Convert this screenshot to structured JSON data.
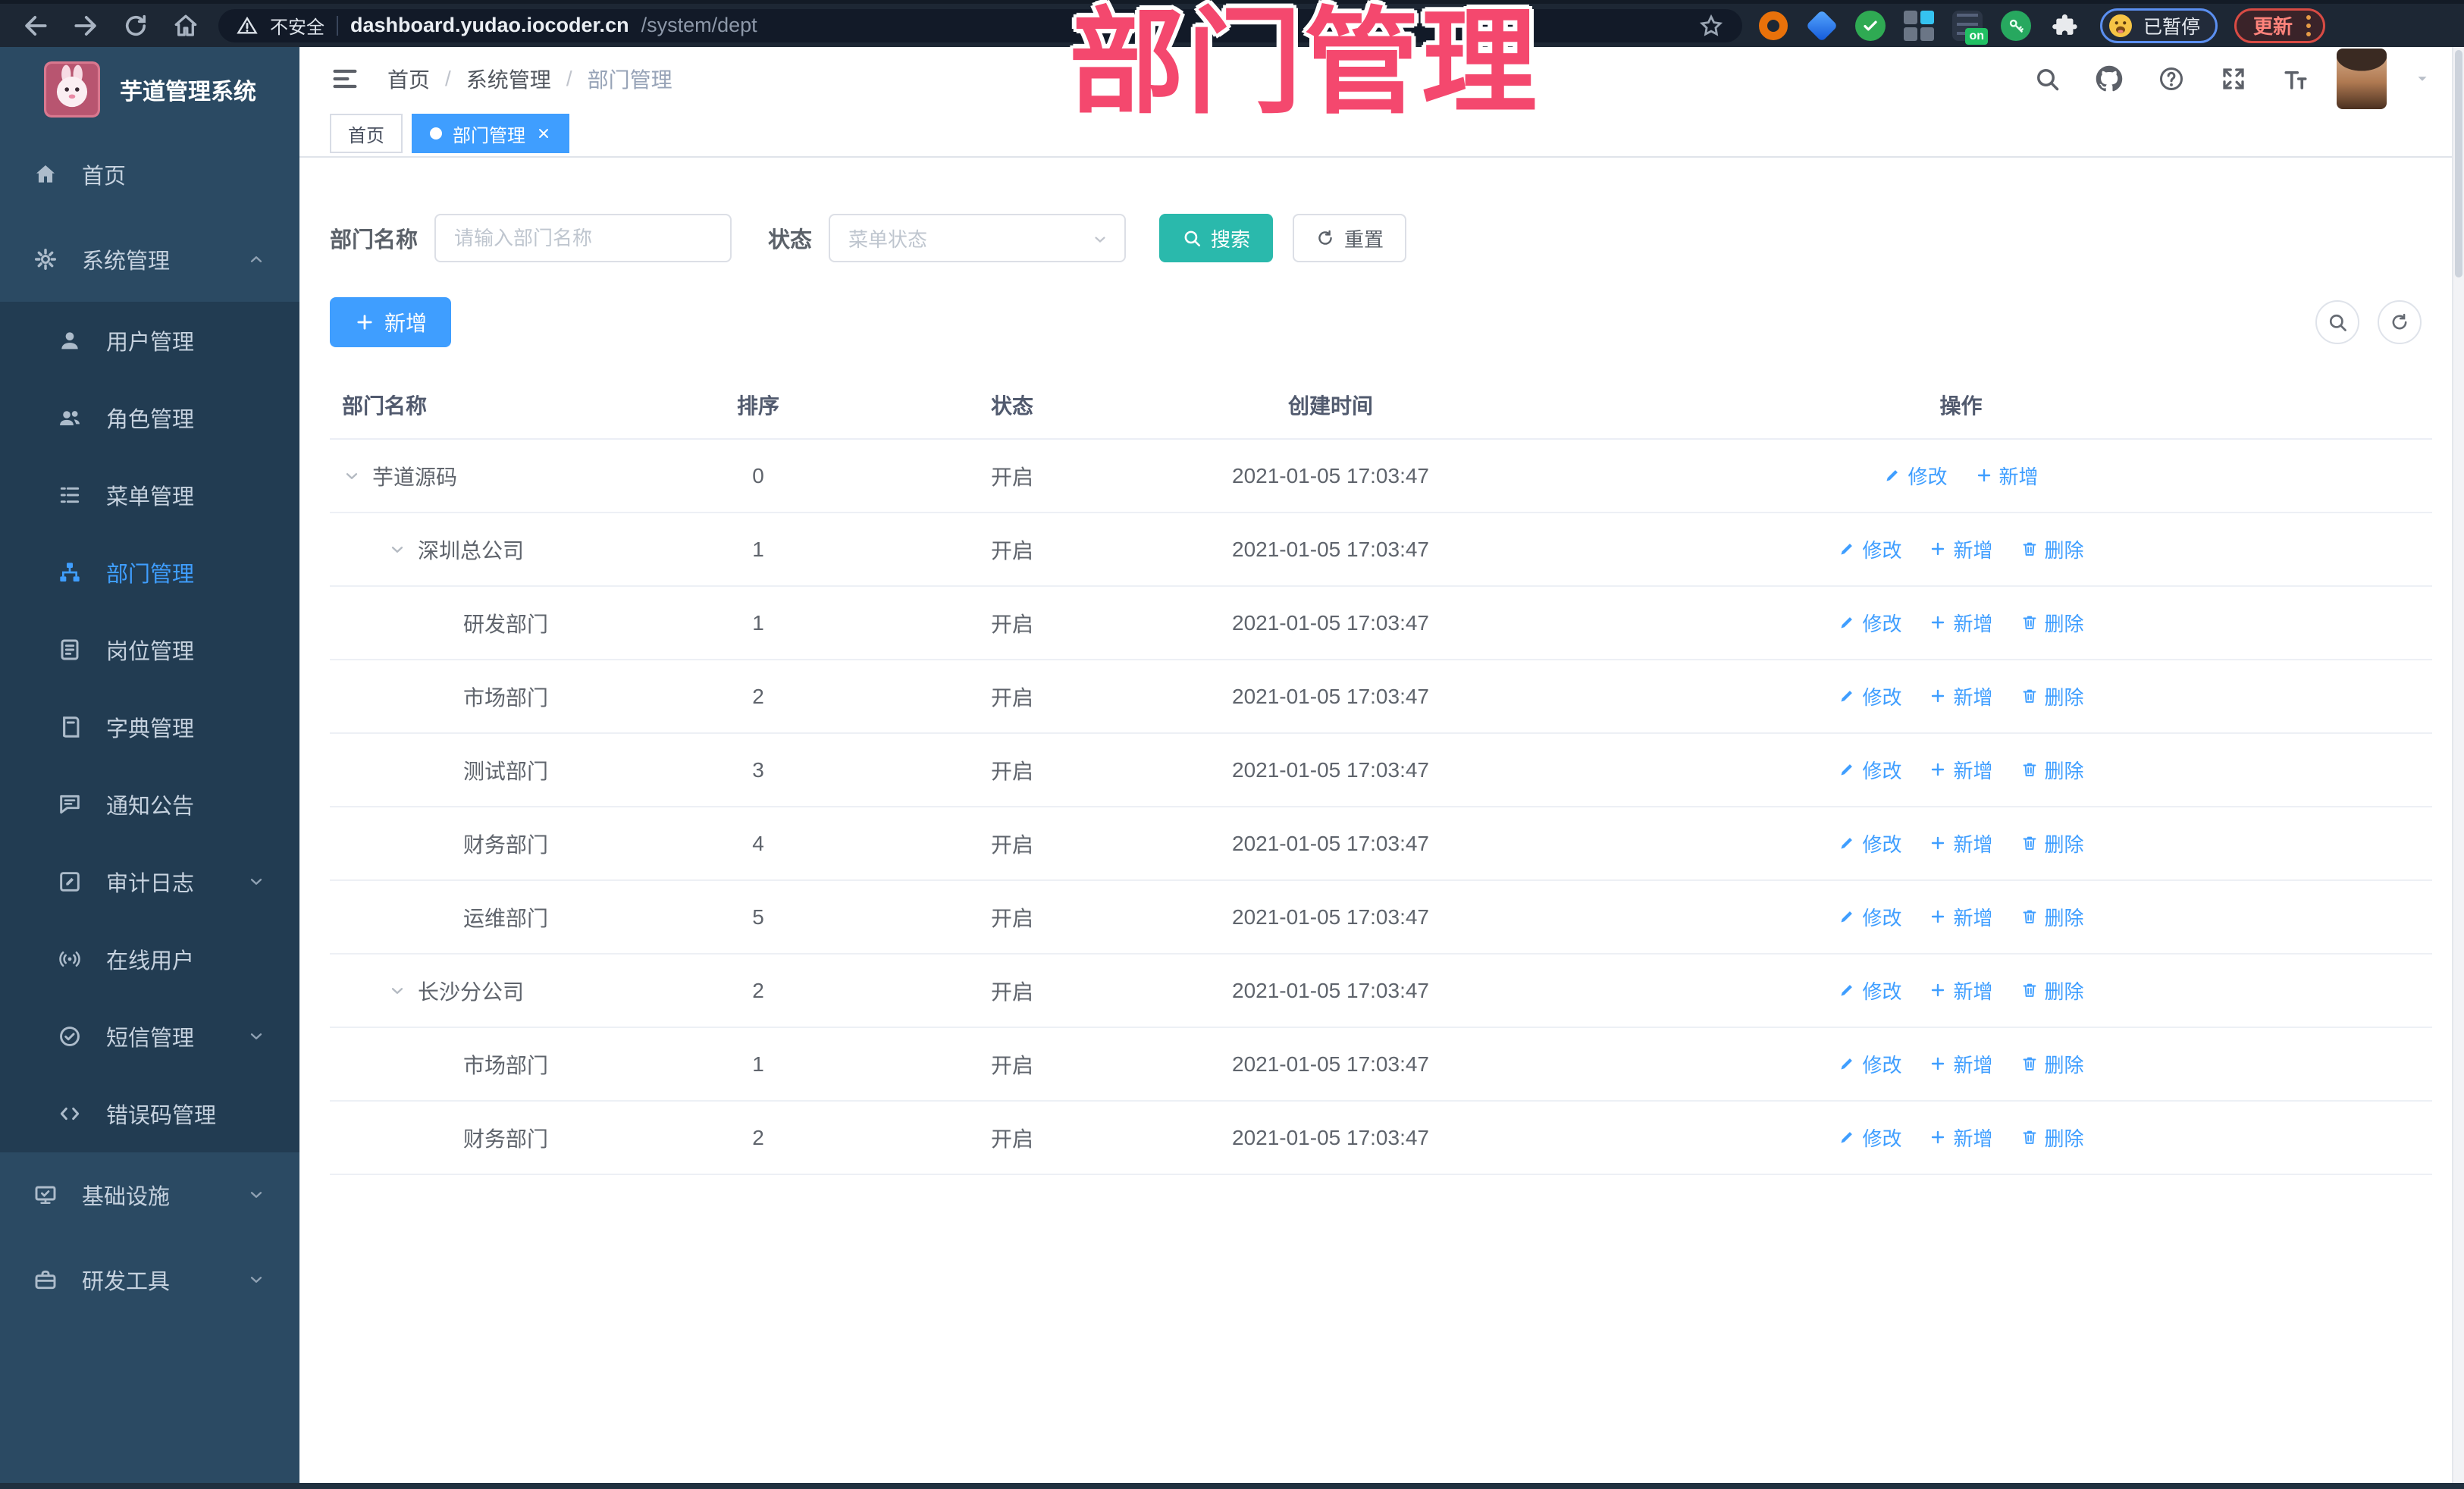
{
  "colors": {
    "accent_blue": "#409eff",
    "teal_button": "#2ab9ac",
    "overlay_pink": "#f4486e",
    "sidebar_bg": "#2b4a63",
    "sidebar_submenu_bg": "#223c52",
    "browser_bar_bg": "#1d2734"
  },
  "overlay": {
    "title": "部门管理"
  },
  "browser": {
    "security_label": "不安全",
    "url_host": "dashboard.yudao.iocoder.cn",
    "url_path": "/system/dept",
    "profile_status": "已暂停",
    "update_label": "更新",
    "extension_badge": "on",
    "extensions": [
      {
        "name": "extension-orange-ring-icon",
        "kind": "donut"
      },
      {
        "name": "extension-blue-gem-icon",
        "kind": "gem"
      },
      {
        "name": "extension-green-check-icon",
        "kind": "check"
      },
      {
        "name": "extension-grid-icon",
        "kind": "grid"
      },
      {
        "name": "extension-list-on-badge-icon",
        "kind": "listbadge"
      },
      {
        "name": "extension-green-key-icon",
        "kind": "green"
      },
      {
        "name": "extension-puzzle-icon",
        "kind": "puzzle"
      }
    ]
  },
  "sidebar": {
    "app_title": "芋道管理系统",
    "menu": [
      {
        "label": "首页",
        "icon": "home-icon"
      },
      {
        "label": "系统管理",
        "icon": "gear-icon",
        "chevron": "up",
        "expanded": true,
        "children": [
          {
            "label": "用户管理",
            "icon": "user-icon"
          },
          {
            "label": "角色管理",
            "icon": "users-icon"
          },
          {
            "label": "菜单管理",
            "icon": "menu-list-icon"
          },
          {
            "label": "部门管理",
            "icon": "org-tree-icon",
            "active": true
          },
          {
            "label": "岗位管理",
            "icon": "badge-icon"
          },
          {
            "label": "字典管理",
            "icon": "dictionary-icon"
          },
          {
            "label": "通知公告",
            "icon": "announcement-icon"
          },
          {
            "label": "审计日志",
            "icon": "audit-log-icon",
            "chevron": "down"
          },
          {
            "label": "在线用户",
            "icon": "online-users-icon"
          },
          {
            "label": "短信管理",
            "icon": "sms-icon",
            "chevron": "down"
          },
          {
            "label": "错误码管理",
            "icon": "error-code-icon"
          }
        ]
      },
      {
        "label": "基础设施",
        "icon": "infrastructure-icon",
        "chevron": "down"
      },
      {
        "label": "研发工具",
        "icon": "dev-tools-icon",
        "chevron": "down"
      }
    ]
  },
  "header": {
    "breadcrumb": [
      "首页",
      "系统管理",
      "部门管理"
    ],
    "breadcrumb_separator": "/",
    "tools": [
      {
        "name": "search-icon"
      },
      {
        "name": "github-icon"
      },
      {
        "name": "help-icon"
      },
      {
        "name": "fullscreen-icon"
      },
      {
        "name": "font-size-icon"
      }
    ]
  },
  "tabs": [
    {
      "label": "首页",
      "active": false
    },
    {
      "label": "部门管理",
      "active": true,
      "closable": true
    }
  ],
  "filters": {
    "name_label": "部门名称",
    "name_placeholder": "请输入部门名称",
    "status_label": "状态",
    "status_placeholder": "菜单状态",
    "search_label": "搜索",
    "reset_label": "重置"
  },
  "toolbar": {
    "add_label": "新增",
    "tools": [
      {
        "name": "search-icon"
      },
      {
        "name": "refresh-icon"
      }
    ]
  },
  "table": {
    "columns": [
      "部门名称",
      "排序",
      "状态",
      "创建时间",
      "操作"
    ],
    "rows": [
      {
        "name": "芋道源码",
        "level": 0,
        "expandable": true,
        "sort": "0",
        "status": "开启",
        "created": "2021-01-05 17:03:47",
        "actions": [
          {
            "label": "修改",
            "icon": "pencil-icon"
          },
          {
            "label": "新增",
            "icon": "plus-icon"
          }
        ]
      },
      {
        "name": "深圳总公司",
        "level": 1,
        "expandable": true,
        "sort": "1",
        "status": "开启",
        "created": "2021-01-05 17:03:47",
        "actions": [
          {
            "label": "修改",
            "icon": "pencil-icon"
          },
          {
            "label": "新增",
            "icon": "plus-icon"
          },
          {
            "label": "删除",
            "icon": "trash-icon"
          }
        ]
      },
      {
        "name": "研发部门",
        "level": 2,
        "expandable": false,
        "sort": "1",
        "status": "开启",
        "created": "2021-01-05 17:03:47",
        "actions": [
          {
            "label": "修改",
            "icon": "pencil-icon"
          },
          {
            "label": "新增",
            "icon": "plus-icon"
          },
          {
            "label": "删除",
            "icon": "trash-icon"
          }
        ]
      },
      {
        "name": "市场部门",
        "level": 2,
        "expandable": false,
        "sort": "2",
        "status": "开启",
        "created": "2021-01-05 17:03:47",
        "actions": [
          {
            "label": "修改",
            "icon": "pencil-icon"
          },
          {
            "label": "新增",
            "icon": "plus-icon"
          },
          {
            "label": "删除",
            "icon": "trash-icon"
          }
        ]
      },
      {
        "name": "测试部门",
        "level": 2,
        "expandable": false,
        "sort": "3",
        "status": "开启",
        "created": "2021-01-05 17:03:47",
        "actions": [
          {
            "label": "修改",
            "icon": "pencil-icon"
          },
          {
            "label": "新增",
            "icon": "plus-icon"
          },
          {
            "label": "删除",
            "icon": "trash-icon"
          }
        ]
      },
      {
        "name": "财务部门",
        "level": 2,
        "expandable": false,
        "sort": "4",
        "status": "开启",
        "created": "2021-01-05 17:03:47",
        "actions": [
          {
            "label": "修改",
            "icon": "pencil-icon"
          },
          {
            "label": "新增",
            "icon": "plus-icon"
          },
          {
            "label": "删除",
            "icon": "trash-icon"
          }
        ]
      },
      {
        "name": "运维部门",
        "level": 2,
        "expandable": false,
        "sort": "5",
        "status": "开启",
        "created": "2021-01-05 17:03:47",
        "actions": [
          {
            "label": "修改",
            "icon": "pencil-icon"
          },
          {
            "label": "新增",
            "icon": "plus-icon"
          },
          {
            "label": "删除",
            "icon": "trash-icon"
          }
        ]
      },
      {
        "name": "长沙分公司",
        "level": 1,
        "expandable": true,
        "sort": "2",
        "status": "开启",
        "created": "2021-01-05 17:03:47",
        "actions": [
          {
            "label": "修改",
            "icon": "pencil-icon"
          },
          {
            "label": "新增",
            "icon": "plus-icon"
          },
          {
            "label": "删除",
            "icon": "trash-icon"
          }
        ]
      },
      {
        "name": "市场部门",
        "level": 2,
        "expandable": false,
        "sort": "1",
        "status": "开启",
        "created": "2021-01-05 17:03:47",
        "actions": [
          {
            "label": "修改",
            "icon": "pencil-icon"
          },
          {
            "label": "新增",
            "icon": "plus-icon"
          },
          {
            "label": "删除",
            "icon": "trash-icon"
          }
        ]
      },
      {
        "name": "财务部门",
        "level": 2,
        "expandable": false,
        "sort": "2",
        "status": "开启",
        "created": "2021-01-05 17:03:47",
        "actions": [
          {
            "label": "修改",
            "icon": "pencil-icon"
          },
          {
            "label": "新增",
            "icon": "plus-icon"
          },
          {
            "label": "删除",
            "icon": "trash-icon"
          }
        ]
      }
    ]
  }
}
